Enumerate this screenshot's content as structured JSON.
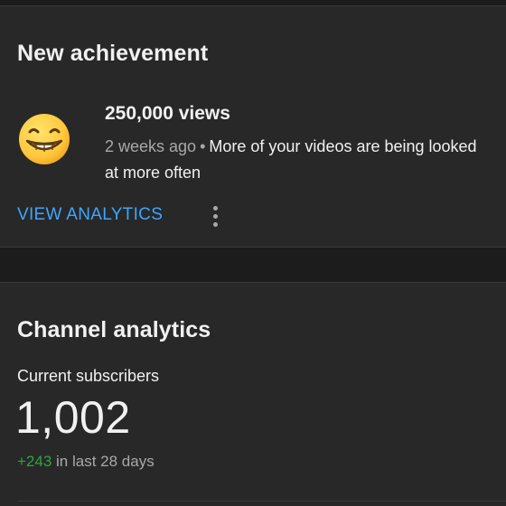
{
  "achievement": {
    "title": "New achievement",
    "icon": "grinning-face-emoji-icon",
    "milestone": "250,000 views",
    "time_ago": "2 weeks ago",
    "separator": "•",
    "description": "More of your videos are being looked at more often",
    "action_label": "VIEW ANALYTICS",
    "more_icon": "more-vert-icon"
  },
  "analytics": {
    "title": "Channel analytics",
    "subscribers_label": "Current subscribers",
    "subscribers_count": "1,002",
    "change_value": "+243",
    "change_period": "in last 28 days"
  },
  "colors": {
    "background": "#1c1c1c",
    "card": "#282828",
    "link": "#3ea6ff",
    "positive": "#2ba640",
    "secondary_text": "#a8a8a8"
  }
}
